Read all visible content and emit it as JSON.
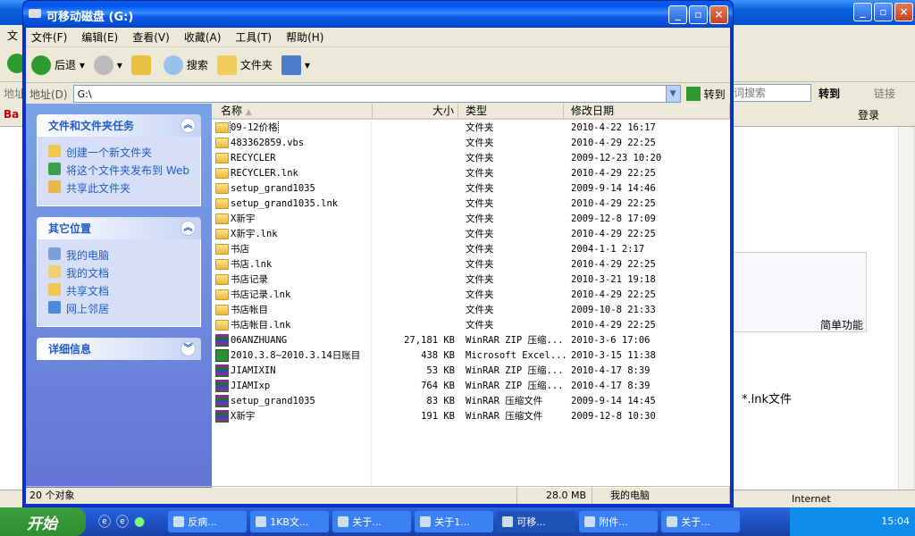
{
  "background_window": {
    "search_placeholder": "词搜索",
    "goto": "转到",
    "links": "链接",
    "login": "登录",
    "simple_function": "简单功能",
    "lnk_text": "*.lnk文件",
    "status_zone": "Internet",
    "menu_first": "文",
    "address_label": "地址",
    "logo_fragment": "Ba"
  },
  "window": {
    "title": "可移动磁盘 (G:)"
  },
  "menu": [
    "文件(F)",
    "编辑(E)",
    "查看(V)",
    "收藏(A)",
    "工具(T)",
    "帮助(H)"
  ],
  "toolbar": {
    "back": "后退",
    "search": "搜索",
    "folders": "文件夹"
  },
  "address": {
    "label": "地址(D)",
    "value": "G:\\",
    "go": "转到"
  },
  "tasks": {
    "title": "文件和文件夹任务",
    "items": [
      "创建一个新文件夹",
      "将这个文件夹发布到 Web",
      "共享此文件夹"
    ]
  },
  "places": {
    "title": "其它位置",
    "items": [
      "我的电脑",
      "我的文档",
      "共享文档",
      "网上邻居"
    ]
  },
  "details": {
    "title": "详细信息"
  },
  "columns": [
    "名称",
    "大小",
    "类型",
    "修改日期"
  ],
  "files": [
    {
      "icon": "folder",
      "name": "09-12价格",
      "size": "",
      "type": "文件夹",
      "date": "2010-4-22 16:17"
    },
    {
      "icon": "folder",
      "name": "483362859.vbs",
      "size": "",
      "type": "文件夹",
      "date": "2010-4-29 22:25"
    },
    {
      "icon": "folder",
      "name": "RECYCLER",
      "size": "",
      "type": "文件夹",
      "date": "2009-12-23 10:20"
    },
    {
      "icon": "folder",
      "name": "RECYCLER.lnk",
      "size": "",
      "type": "文件夹",
      "date": "2010-4-29 22:25"
    },
    {
      "icon": "folder",
      "name": "setup_grand1035",
      "size": "",
      "type": "文件夹",
      "date": "2009-9-14 14:46"
    },
    {
      "icon": "folder",
      "name": "setup_grand1035.lnk",
      "size": "",
      "type": "文件夹",
      "date": "2010-4-29 22:25"
    },
    {
      "icon": "folder",
      "name": "X新宇",
      "size": "",
      "type": "文件夹",
      "date": "2009-12-8 17:09"
    },
    {
      "icon": "folder",
      "name": "X新宇.lnk",
      "size": "",
      "type": "文件夹",
      "date": "2010-4-29 22:25"
    },
    {
      "icon": "folder",
      "name": "书店",
      "size": "",
      "type": "文件夹",
      "date": "2004-1-1 2:17"
    },
    {
      "icon": "folder",
      "name": "书店.lnk",
      "size": "",
      "type": "文件夹",
      "date": "2010-4-29 22:25"
    },
    {
      "icon": "folder",
      "name": "书店记录",
      "size": "",
      "type": "文件夹",
      "date": "2010-3-21 19:18"
    },
    {
      "icon": "folder",
      "name": "书店记录.lnk",
      "size": "",
      "type": "文件夹",
      "date": "2010-4-29 22:25"
    },
    {
      "icon": "folder",
      "name": "书店帐目",
      "size": "",
      "type": "文件夹",
      "date": "2009-10-8 21:33"
    },
    {
      "icon": "folder",
      "name": "书店帐目.lnk",
      "size": "",
      "type": "文件夹",
      "date": "2010-4-29 22:25"
    },
    {
      "icon": "rar",
      "name": "06ANZHUANG",
      "size": "27,181 KB",
      "type": "WinRAR ZIP 压缩...",
      "date": "2010-3-6 17:06"
    },
    {
      "icon": "xls",
      "name": "2010.3.8~2010.3.14日账目",
      "size": "438 KB",
      "type": "Microsoft Excel...",
      "date": "2010-3-15 11:38"
    },
    {
      "icon": "rar",
      "name": "JIAMIXIN",
      "size": "53 KB",
      "type": "WinRAR ZIP 压缩...",
      "date": "2010-4-17 8:39"
    },
    {
      "icon": "rar",
      "name": "JIAMIxp",
      "size": "764 KB",
      "type": "WinRAR ZIP 压缩...",
      "date": "2010-4-17 8:39"
    },
    {
      "icon": "rar",
      "name": "setup_grand1035",
      "size": "83 KB",
      "type": "WinRAR 压缩文件",
      "date": "2009-9-14 14:45"
    },
    {
      "icon": "rar",
      "name": "X新宇",
      "size": "191 KB",
      "type": "WinRAR 压缩文件",
      "date": "2009-12-8 10:30"
    }
  ],
  "status": {
    "count": "20 个对象",
    "size": "28.0 MB",
    "location": "我的电脑"
  },
  "taskbar": {
    "start": "开始",
    "tasks": [
      "反病...",
      "1KB文...",
      "关于...",
      "关于1...",
      "可移...",
      "附件...",
      "关于..."
    ],
    "active": 4,
    "clock": "15:04"
  }
}
